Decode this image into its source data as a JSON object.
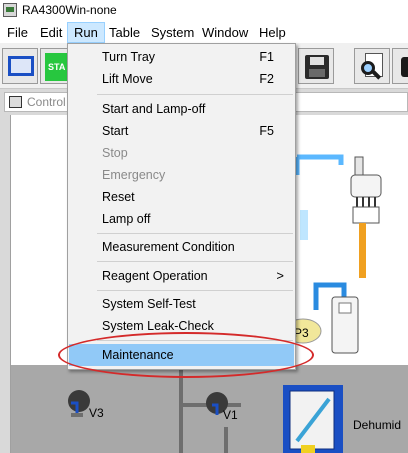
{
  "window": {
    "title": "RA4300Win-none"
  },
  "menubar": {
    "items": [
      {
        "label": "File"
      },
      {
        "label": "Edit"
      },
      {
        "label": "Run"
      },
      {
        "label": "Table"
      },
      {
        "label": "System"
      },
      {
        "label": "Window"
      },
      {
        "label": "Help"
      }
    ],
    "active_item": "Run"
  },
  "toolbar": {
    "buttons": [
      {
        "icon": "window-icon"
      },
      {
        "icon": "start-icon",
        "label": "STA"
      },
      {
        "icon": "save-icon"
      },
      {
        "icon": "search-document-icon"
      },
      {
        "icon": "tray-icon"
      }
    ]
  },
  "child_window": {
    "title": "Control"
  },
  "diagram": {
    "labels": {
      "p3": "P3",
      "v3": "V3",
      "v1": "V1",
      "dehumidifier": "Dehumid"
    }
  },
  "run_menu": {
    "items": [
      {
        "label": "Turn Tray",
        "shortcut": "F1",
        "enabled": true
      },
      {
        "label": "Lift Move",
        "shortcut": "F2",
        "enabled": true
      },
      {
        "label": "Start and Lamp-off",
        "shortcut": "",
        "enabled": true
      },
      {
        "label": "Start",
        "shortcut": "F5",
        "enabled": true
      },
      {
        "label": "Stop",
        "shortcut": "",
        "enabled": false
      },
      {
        "label": "Emergency",
        "shortcut": "",
        "enabled": false
      },
      {
        "label": "Reset",
        "shortcut": "",
        "enabled": true
      },
      {
        "label": "Lamp off",
        "shortcut": "",
        "enabled": true
      },
      {
        "label": "Measurement Condition",
        "shortcut": "",
        "enabled": true
      },
      {
        "label": "Reagent Operation",
        "shortcut": "",
        "enabled": true,
        "submenu_arrow": ">"
      },
      {
        "label": "System Self-Test",
        "shortcut": "",
        "enabled": true
      },
      {
        "label": "System Leak-Check",
        "shortcut": "",
        "enabled": true
      },
      {
        "label": "Maintenance",
        "shortcut": "",
        "enabled": true,
        "highlighted": true
      }
    ]
  },
  "annotation": {
    "color": "#d42a2a",
    "target": "Maintenance"
  },
  "colors": {
    "menu_highlight": "#91c9f7",
    "menubar_active": "#cce8ff",
    "diagram_blue": "#1a4fc4",
    "diagram_orange": "#f0a020"
  }
}
